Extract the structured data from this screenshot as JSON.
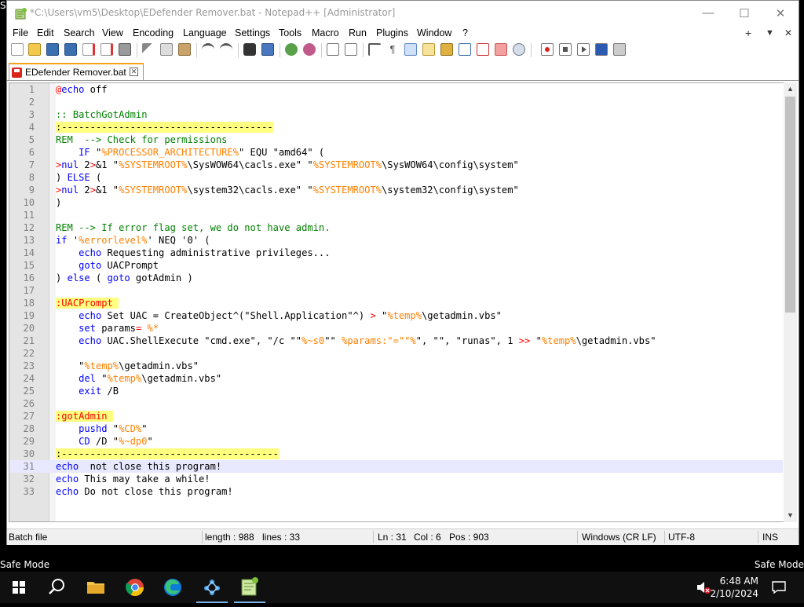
{
  "desktop": {
    "corner_tag": "Sa",
    "safe_mode_left": "Safe Mode",
    "safe_mode_right": "Safe Mode"
  },
  "window": {
    "title": "*C:\\Users\\vm5\\Desktop\\EDefender Remover.bat - Notepad++ [Administrator]",
    "controls": {
      "minimize": "—",
      "maximize": "☐",
      "close": "✕"
    }
  },
  "menubar": {
    "items": [
      "File",
      "Edit",
      "Search",
      "View",
      "Encoding",
      "Language",
      "Settings",
      "Tools",
      "Macro",
      "Run",
      "Plugins",
      "Window",
      "?"
    ],
    "right": {
      "add": "+",
      "dropdown": "▼",
      "close": "✕"
    }
  },
  "tab": {
    "label": "EDefender Remover.bat",
    "close": "✕"
  },
  "editor": {
    "current_line": 31,
    "line_numbers": [
      "1",
      "2",
      "3",
      "4",
      "5",
      "6",
      "7",
      "8",
      "9",
      "10",
      "11",
      "12",
      "13",
      "14",
      "15",
      "16",
      "17",
      "18",
      "19",
      "20",
      "21",
      "22",
      "23",
      "24",
      "25",
      "26",
      "27",
      "28",
      "29",
      "30",
      "31",
      "32",
      "33"
    ]
  },
  "statusbar": {
    "language": "Batch file",
    "length": "length : 988",
    "lines": "lines : 33",
    "ln": "Ln : 31",
    "col": "Col : 6",
    "pos": "Pos : 903",
    "eol": "Windows (CR LF)",
    "encoding": "UTF-8",
    "mode": "INS"
  },
  "taskbar": {
    "clock_time": "6:48 AM",
    "clock_date": "2/10/2024",
    "icons": [
      "windows-start-icon",
      "search-icon",
      "file-explorer-icon",
      "chrome-icon",
      "edge-icon",
      "network-app-icon",
      "notepad-plus-plus-icon"
    ]
  },
  "colors": {
    "keyword": "#0000ff",
    "comment": "#008000",
    "label_highlight": "#ffff80",
    "variable": "#ff8000",
    "operator": "#ff0000",
    "current_line": "#e8e8ff"
  }
}
